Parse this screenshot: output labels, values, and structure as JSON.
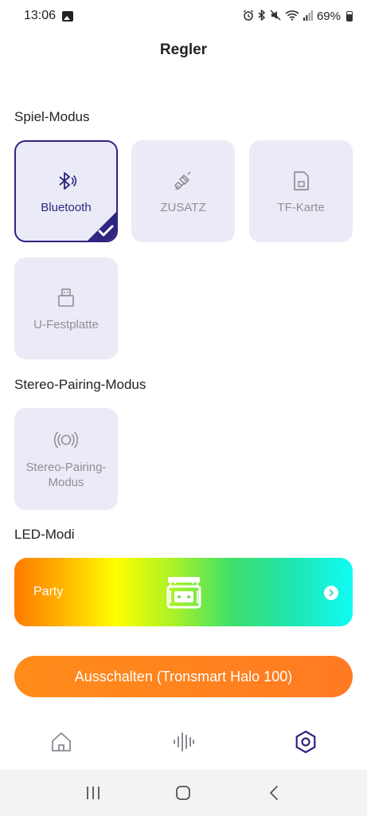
{
  "status_bar": {
    "time": "13:06",
    "battery": "69%",
    "icons": [
      "image-icon",
      "alarm-icon",
      "bluetooth-icon",
      "mute-icon",
      "wifi-icon",
      "signal-icon",
      "battery-icon"
    ]
  },
  "header": {
    "title": "Regler"
  },
  "play_mode": {
    "title": "Spiel-Modus",
    "tiles": [
      {
        "label": "Bluetooth",
        "icon": "bluetooth-icon",
        "active": true
      },
      {
        "label": "ZUSATZ",
        "icon": "aux-cable-icon",
        "active": false
      },
      {
        "label": "TF-Karte",
        "icon": "sd-card-icon",
        "active": false
      },
      {
        "label": "U-Festplatte",
        "icon": "usb-drive-icon",
        "active": false
      }
    ]
  },
  "stereo_mode": {
    "title": "Stereo-Pairing-Modus",
    "tile": {
      "label": "Stereo-Pairing-Modus",
      "icon": "stereo-pairing-icon"
    }
  },
  "led_mode": {
    "title": "LED-Modi",
    "current": "Party",
    "icon": "party-speaker-icon"
  },
  "power": {
    "label": "Ausschalten (Tronsmart Halo 100)"
  },
  "bottom_nav": [
    "home-icon",
    "equalizer-icon",
    "settings-hex-icon"
  ],
  "colors": {
    "accent": "#2e2680",
    "orange": "#ff8020",
    "tile_bg": "#ebebf7"
  }
}
